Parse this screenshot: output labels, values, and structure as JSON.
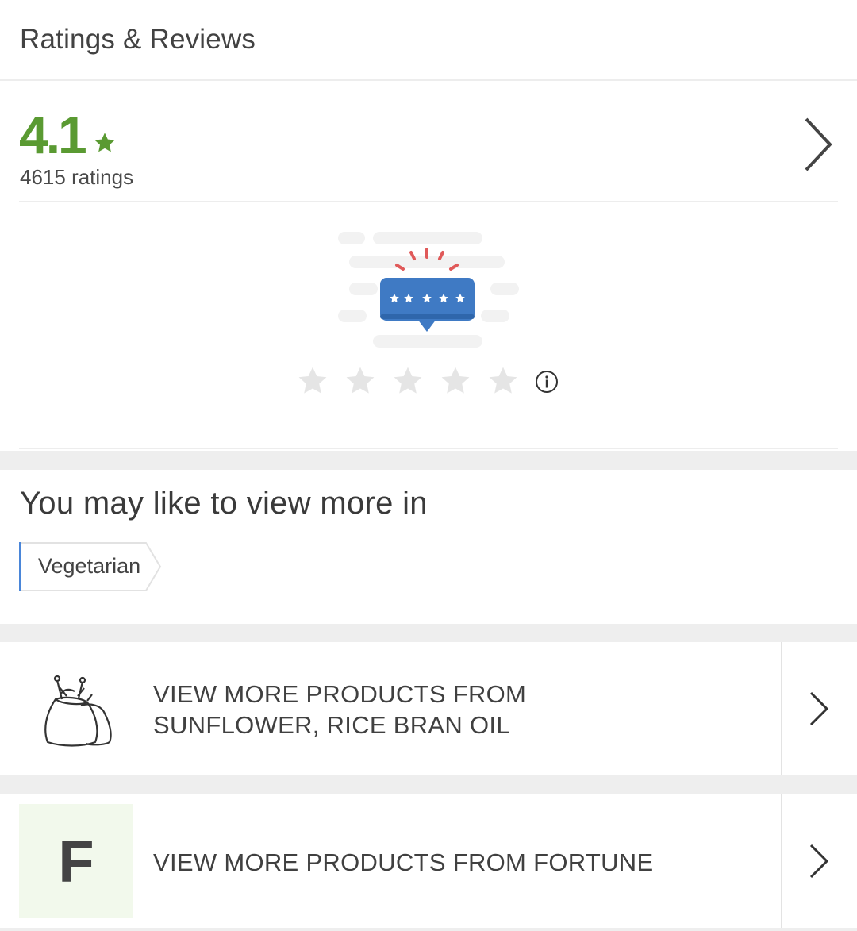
{
  "header": {
    "title": "Ratings & Reviews"
  },
  "rating": {
    "value": "4.1",
    "count_label": "4615 ratings",
    "accent_color": "#5a9a32"
  },
  "rate_widget": {
    "stars": 5,
    "icon": "info-icon"
  },
  "may_like": {
    "title": "You may like to view more in",
    "tag": "Vegetarian"
  },
  "links": [
    {
      "icon": "grain-sacks-icon",
      "text_line1": "VIEW MORE PRODUCTS FROM",
      "text_line2": "SUNFLOWER, RICE BRAN OIL"
    },
    {
      "icon_letter": "F",
      "text": "VIEW MORE PRODUCTS FROM FORTUNE"
    }
  ]
}
